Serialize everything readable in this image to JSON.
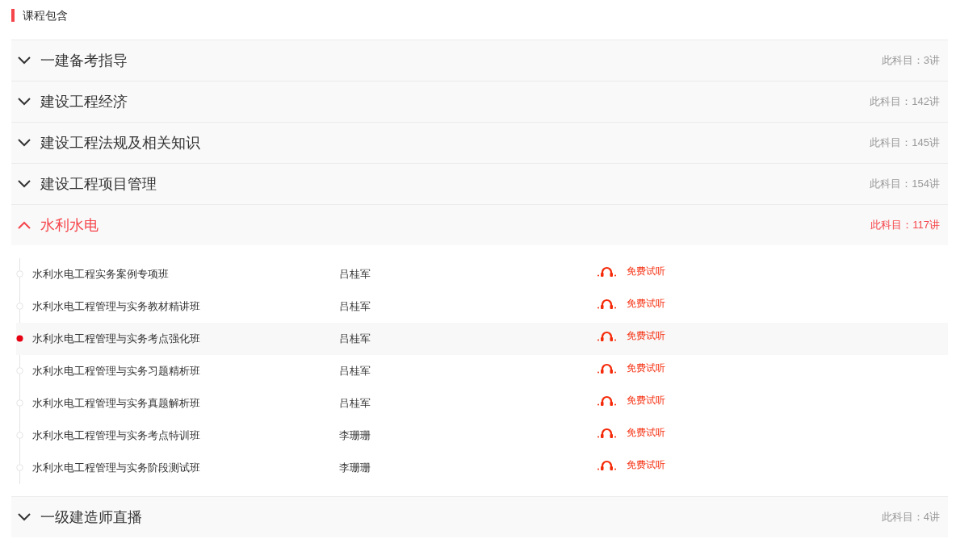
{
  "section_title": "课程包含",
  "subjects": [
    {
      "name": "一建备考指导",
      "count": "此科目：3讲",
      "expanded": false
    },
    {
      "name": "建设工程经济",
      "count": "此科目：142讲",
      "expanded": false
    },
    {
      "name": "建设工程法规及相关知识",
      "count": "此科目：145讲",
      "expanded": false
    },
    {
      "name": "建设工程项目管理",
      "count": "此科目：154讲",
      "expanded": false
    },
    {
      "name": "水利水电",
      "count": "此科目：117讲",
      "expanded": true,
      "lessons": [
        {
          "title": "水利水电工程实务案例专项班",
          "teacher": "吕桂军",
          "trial": "免费试听",
          "selected": false
        },
        {
          "title": "水利水电工程管理与实务教材精讲班",
          "teacher": "吕桂军",
          "trial": "免费试听",
          "selected": false
        },
        {
          "title": "水利水电工程管理与实务考点强化班",
          "teacher": "吕桂军",
          "trial": "免费试听",
          "selected": true
        },
        {
          "title": "水利水电工程管理与实务习题精析班",
          "teacher": "吕桂军",
          "trial": "免费试听",
          "selected": false
        },
        {
          "title": "水利水电工程管理与实务真题解析班",
          "teacher": "吕桂军",
          "trial": "免费试听",
          "selected": false
        },
        {
          "title": "水利水电工程管理与实务考点特训班",
          "teacher": "李珊珊",
          "trial": "免费试听",
          "selected": false
        },
        {
          "title": "水利水电工程管理与实务阶段测试班",
          "teacher": "李珊珊",
          "trial": "免费试听",
          "selected": false
        }
      ]
    },
    {
      "name": "一级建造师直播",
      "count": "此科目：4讲",
      "expanded": false
    }
  ]
}
